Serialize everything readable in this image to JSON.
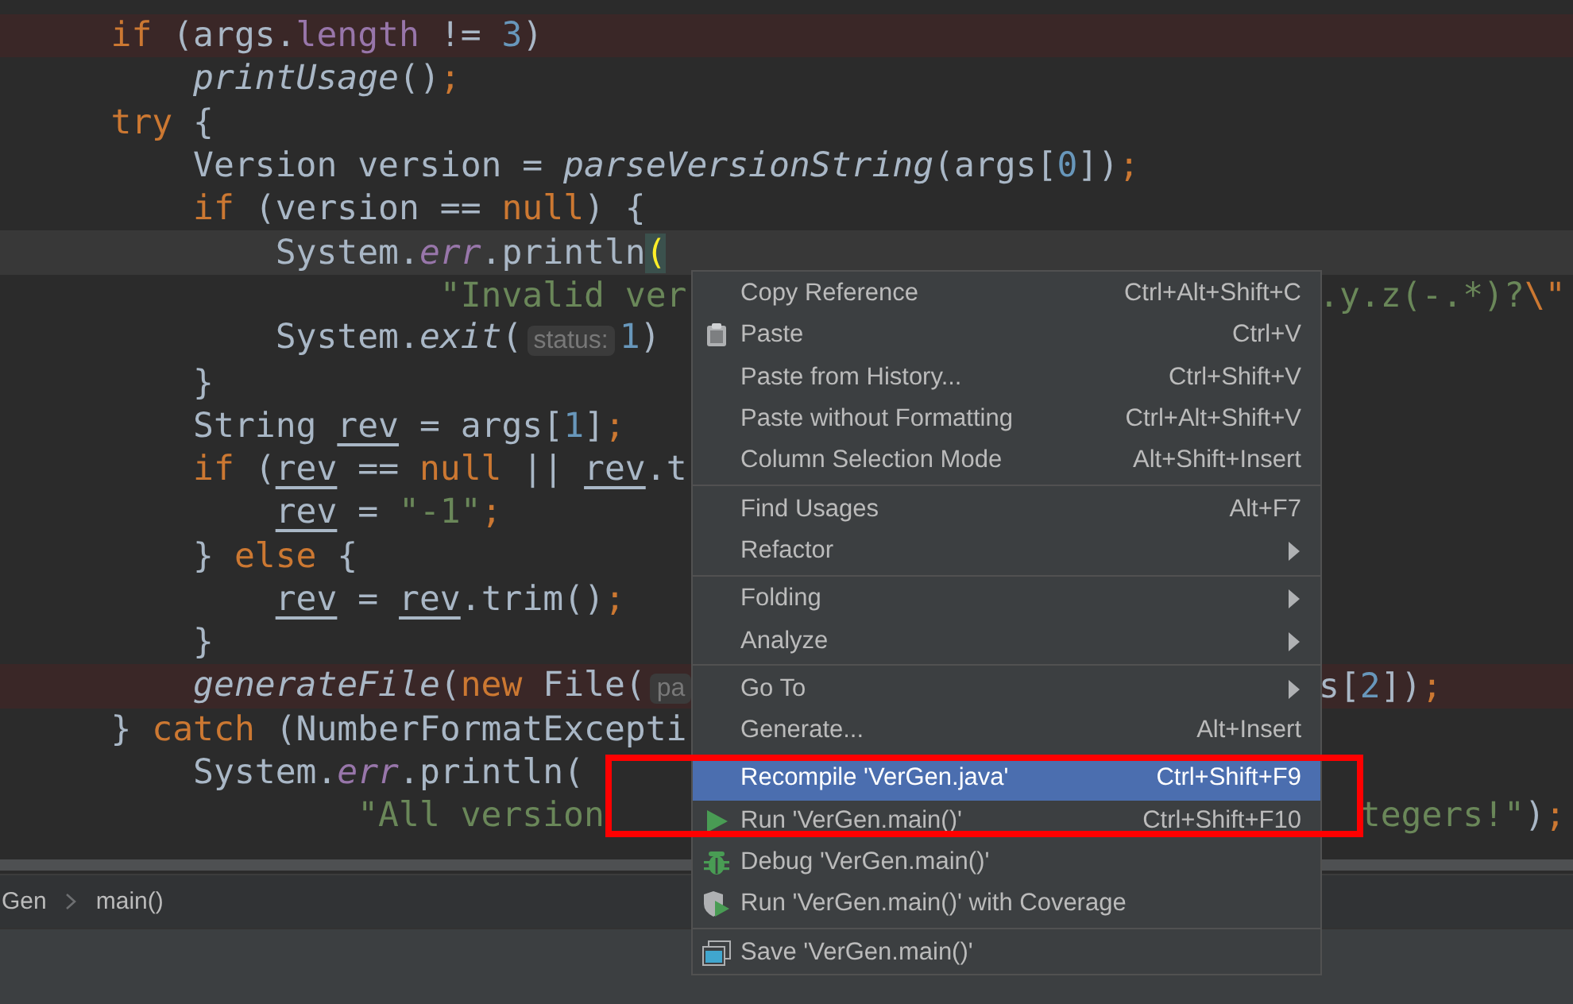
{
  "code": {
    "lines": [
      {
        "highlighted": true,
        "current": false,
        "tokens": [
          {
            "kind": "kw",
            "text": "    if"
          },
          {
            "kind": "plain",
            "text": " (args."
          },
          {
            "kind": "field",
            "text": "length"
          },
          {
            "kind": "plain",
            "text": " != "
          },
          {
            "kind": "num",
            "text": "3"
          },
          {
            "kind": "plain",
            "text": ")"
          }
        ]
      },
      {
        "highlighted": false,
        "current": false,
        "tokens": [
          {
            "kind": "call",
            "text": "        printUsage"
          },
          {
            "kind": "plain",
            "text": "()"
          },
          {
            "kind": "kw",
            "text": ";"
          }
        ]
      },
      {
        "highlighted": false,
        "current": false,
        "tokens": [
          {
            "kind": "kw",
            "text": "    try"
          },
          {
            "kind": "plain",
            "text": " {"
          }
        ]
      },
      {
        "highlighted": false,
        "current": false,
        "tokens": [
          {
            "kind": "plain",
            "text": "        Version version = "
          },
          {
            "kind": "call",
            "text": "parseVersionString"
          },
          {
            "kind": "plain",
            "text": "(args["
          },
          {
            "kind": "num",
            "text": "0"
          },
          {
            "kind": "plain",
            "text": "])"
          },
          {
            "kind": "kw",
            "text": ";"
          }
        ]
      },
      {
        "highlighted": false,
        "current": false,
        "tokens": [
          {
            "kind": "kw",
            "text": "        if"
          },
          {
            "kind": "plain",
            "text": " (version == "
          },
          {
            "kind": "kw",
            "text": "null"
          },
          {
            "kind": "plain",
            "text": ") {"
          }
        ]
      },
      {
        "highlighted": false,
        "current": true,
        "tokens": [
          {
            "kind": "plain",
            "text": "            System."
          },
          {
            "kind": "sfield",
            "text": "err"
          },
          {
            "kind": "plain",
            "text": ".println"
          },
          {
            "kind": "match",
            "text": "("
          }
        ]
      },
      {
        "highlighted": false,
        "current": false,
        "tokens": [
          {
            "kind": "str",
            "text": "                    \"Invalid ver"
          }
        ],
        "tail": [
          {
            "kind": "str",
            "text": ".y.z(-.*)?"
          },
          {
            "kind": "esc",
            "text": "\\\""
          }
        ]
      },
      {
        "highlighted": false,
        "current": false,
        "tokens": [
          {
            "kind": "plain",
            "text": "            System."
          },
          {
            "kind": "call",
            "text": "exit"
          },
          {
            "kind": "plain",
            "text": "("
          },
          {
            "kind": "hint",
            "text": "status:"
          },
          {
            "kind": "num",
            "text": "1"
          },
          {
            "kind": "plain",
            "text": ")"
          }
        ]
      },
      {
        "highlighted": false,
        "current": false,
        "tokens": [
          {
            "kind": "plain",
            "text": "        }"
          }
        ]
      },
      {
        "highlighted": false,
        "current": false,
        "tokens": [
          {
            "kind": "plain",
            "text": "        String "
          },
          {
            "kind": "var",
            "text": "rev"
          },
          {
            "kind": "plain",
            "text": " = args["
          },
          {
            "kind": "num",
            "text": "1"
          },
          {
            "kind": "plain",
            "text": "]"
          },
          {
            "kind": "kw",
            "text": ";"
          }
        ]
      },
      {
        "highlighted": false,
        "current": false,
        "tokens": [
          {
            "kind": "kw",
            "text": "        if"
          },
          {
            "kind": "plain",
            "text": " ("
          },
          {
            "kind": "var",
            "text": "rev"
          },
          {
            "kind": "plain",
            "text": " == "
          },
          {
            "kind": "kw",
            "text": "null"
          },
          {
            "kind": "plain",
            "text": " || "
          },
          {
            "kind": "var",
            "text": "rev"
          },
          {
            "kind": "plain",
            "text": ".t"
          }
        ]
      },
      {
        "highlighted": false,
        "current": false,
        "tokens": [
          {
            "kind": "var",
            "text": "            rev"
          },
          {
            "kind": "plain",
            "text": " = "
          },
          {
            "kind": "str",
            "text": "\"-1\""
          },
          {
            "kind": "kw",
            "text": ";"
          }
        ]
      },
      {
        "highlighted": false,
        "current": false,
        "tokens": [
          {
            "kind": "plain",
            "text": "        } "
          },
          {
            "kind": "kw",
            "text": "else"
          },
          {
            "kind": "plain",
            "text": " {"
          }
        ]
      },
      {
        "highlighted": false,
        "current": false,
        "tokens": [
          {
            "kind": "var",
            "text": "            rev"
          },
          {
            "kind": "plain",
            "text": " = "
          },
          {
            "kind": "var",
            "text": "rev"
          },
          {
            "kind": "plain",
            "text": ".trim()"
          },
          {
            "kind": "kw",
            "text": ";"
          }
        ]
      },
      {
        "highlighted": false,
        "current": false,
        "tokens": [
          {
            "kind": "plain",
            "text": "        }"
          }
        ]
      },
      {
        "highlighted": true,
        "current": false,
        "tokens": [
          {
            "kind": "call",
            "text": "        generateFile"
          },
          {
            "kind": "plain",
            "text": "("
          },
          {
            "kind": "kw",
            "text": "new"
          },
          {
            "kind": "plain",
            "text": " File("
          },
          {
            "kind": "hint",
            "text": "pa"
          }
        ],
        "tail": [
          {
            "kind": "plain",
            "text": "s["
          },
          {
            "kind": "num",
            "text": "2"
          },
          {
            "kind": "plain",
            "text": "])"
          },
          {
            "kind": "kw",
            "text": ";"
          }
        ]
      },
      {
        "highlighted": false,
        "current": false,
        "tokens": [
          {
            "kind": "plain",
            "text": "    } "
          },
          {
            "kind": "kw",
            "text": "catch"
          },
          {
            "kind": "plain",
            "text": " (NumberFormatExcepti"
          }
        ]
      },
      {
        "highlighted": false,
        "current": false,
        "tokens": [
          {
            "kind": "plain",
            "text": "        System."
          },
          {
            "kind": "sfield",
            "text": "err"
          },
          {
            "kind": "plain",
            "text": ".println("
          }
        ]
      },
      {
        "highlighted": false,
        "current": false,
        "tokens": [
          {
            "kind": "str",
            "text": "                \"All version"
          }
        ],
        "tail": [
          {
            "kind": "str",
            "text": "  tegers!\""
          },
          {
            "kind": "plain",
            "text": ")"
          },
          {
            "kind": "kw",
            "text": ";"
          }
        ]
      }
    ]
  },
  "breadcrumb": [
    "Gen",
    "main()"
  ],
  "context_menu": {
    "groups": [
      [
        {
          "kind": "plain",
          "label": "Copy Reference",
          "shortcut": "Ctrl+Alt+Shift+C",
          "submenu": false,
          "selected": false
        },
        {
          "kind": "paste",
          "label": "Paste",
          "shortcut": "Ctrl+V",
          "submenu": false,
          "selected": false
        },
        {
          "kind": "plain",
          "label": "Paste from History...",
          "shortcut": "Ctrl+Shift+V",
          "submenu": false,
          "selected": false
        },
        {
          "kind": "plain",
          "label": "Paste without Formatting",
          "shortcut": "Ctrl+Alt+Shift+V",
          "submenu": false,
          "selected": false
        },
        {
          "kind": "plain",
          "label": "Column Selection Mode",
          "shortcut": "Alt+Shift+Insert",
          "submenu": false,
          "selected": false
        }
      ],
      [
        {
          "kind": "plain",
          "label": "Find Usages",
          "shortcut": "Alt+F7",
          "submenu": false,
          "selected": false
        },
        {
          "kind": "plain",
          "label": "Refactor",
          "submenu": true,
          "selected": false
        }
      ],
      [
        {
          "kind": "plain",
          "label": "Folding",
          "submenu": true,
          "selected": false
        },
        {
          "kind": "plain",
          "label": "Analyze",
          "submenu": true,
          "selected": false
        }
      ],
      [
        {
          "kind": "plain",
          "label": "Go To",
          "submenu": true,
          "selected": false
        },
        {
          "kind": "plain",
          "label": "Generate...",
          "shortcut": "Alt+Insert",
          "submenu": false,
          "selected": false
        }
      ],
      [
        {
          "kind": "plain",
          "label": "Recompile 'VerGen.java'",
          "shortcut": "Ctrl+Shift+F9",
          "submenu": false,
          "selected": true
        },
        {
          "kind": "run",
          "label": "Run 'VerGen.main()'",
          "shortcut": "Ctrl+Shift+F10",
          "submenu": false,
          "selected": false
        },
        {
          "kind": "debug",
          "label": "Debug 'VerGen.main()'",
          "submenu": false,
          "selected": false
        },
        {
          "kind": "coverage",
          "label": "Run 'VerGen.main()' with Coverage",
          "submenu": false,
          "selected": false
        }
      ],
      [
        {
          "kind": "save",
          "label": "Save 'VerGen.main()'",
          "submenu": false,
          "selected": false
        }
      ]
    ]
  }
}
